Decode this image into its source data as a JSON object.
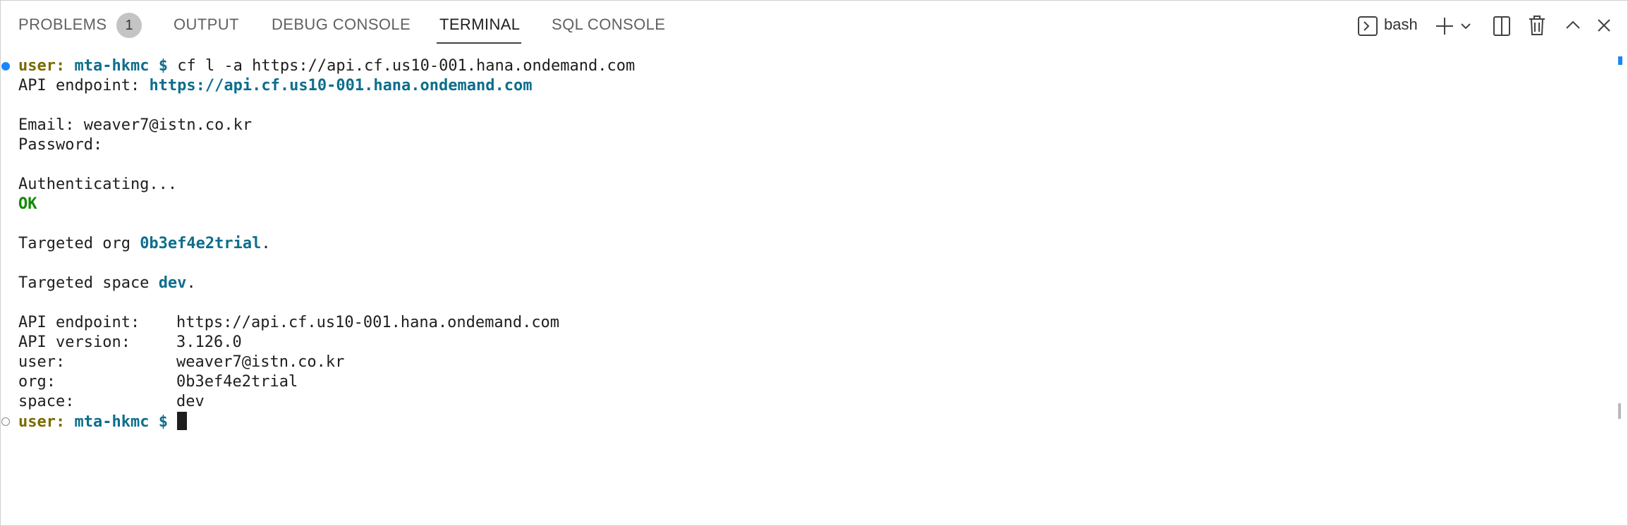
{
  "tabs": {
    "problems": "PROBLEMS",
    "problems_count": "1",
    "output": "OUTPUT",
    "debug_console": "DEBUG CONSOLE",
    "terminal": "TERMINAL",
    "sql_console": "SQL CONSOLE",
    "active": "TERMINAL"
  },
  "toolbar": {
    "shell_name": "bash",
    "icons": [
      "terminal-icon",
      "plus-icon",
      "chevron-down-icon",
      "split-icon",
      "trash-icon",
      "chevron-up-icon",
      "close-icon"
    ]
  },
  "terminal": {
    "prompt_user": "user:",
    "prompt_dir": "mta-hkmc",
    "prompt_symbol": "$",
    "command": "cf l -a https://api.cf.us10-001.hana.ondemand.com",
    "api_endpoint_label": "API endpoint:",
    "api_endpoint_url": "https://api.cf.us10-001.hana.ondemand.com",
    "email_line": "Email: weaver7@istn.co.kr",
    "password_line": "Password:",
    "authenticating": "Authenticating...",
    "ok": "OK",
    "targeted_org_prefix": "Targeted org ",
    "targeted_org": "0b3ef4e2trial",
    "targeted_space_prefix": "Targeted space ",
    "targeted_space": "dev",
    "period": ".",
    "summary": [
      {
        "key": "API endpoint:",
        "value": "https://api.cf.us10-001.hana.ondemand.com"
      },
      {
        "key": "API version:",
        "value": "3.126.0"
      },
      {
        "key": "user:",
        "value": "weaver7@istn.co.kr"
      },
      {
        "key": "org:",
        "value": "0b3ef4e2trial"
      },
      {
        "key": "space:",
        "value": "dev"
      }
    ]
  },
  "colors": {
    "prompt_user": "#7a6a00",
    "prompt_dir": "#0d6e8c",
    "ok": "#108a00",
    "highlight": "#0d6e8c"
  }
}
